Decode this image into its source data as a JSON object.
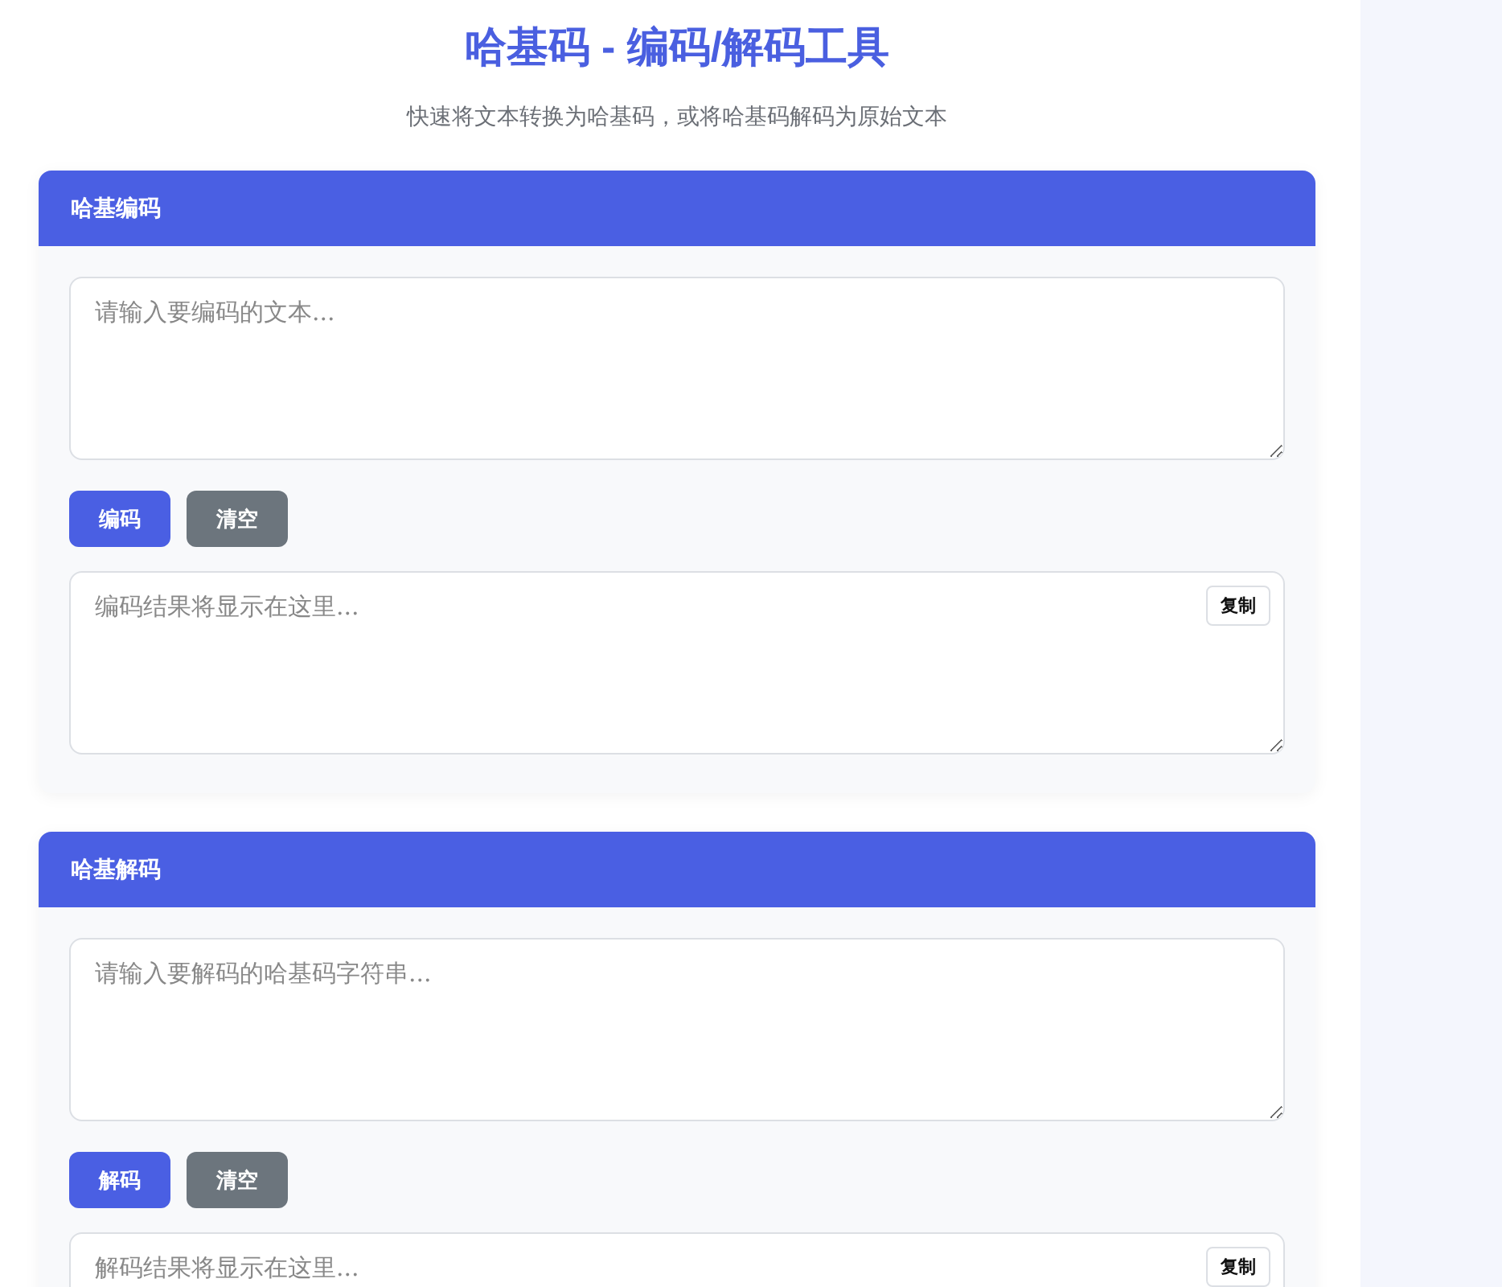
{
  "title": "哈基码 - 编码/解码工具",
  "subtitle": "快速将文本转换为哈基码，或将哈基码解码为原始文本",
  "panels": [
    {
      "heading": "哈基编码",
      "input": {
        "placeholder": "请输入要编码的文本..."
      },
      "buttons": [
        {
          "label": "编码",
          "kind": "primary"
        },
        {
          "label": "清空",
          "kind": "secondary"
        }
      ],
      "output": {
        "placeholder": "编码结果将显示在这里...",
        "copy": "复制"
      }
    },
    {
      "heading": "哈基解码",
      "input": {
        "placeholder": "请输入要解码的哈基码字符串..."
      },
      "buttons": [
        {
          "label": "解码",
          "kind": "primary"
        },
        {
          "label": "清空",
          "kind": "secondary"
        }
      ],
      "output": {
        "placeholder": "解码结果将显示在这里...",
        "copy": "复制"
      }
    }
  ]
}
